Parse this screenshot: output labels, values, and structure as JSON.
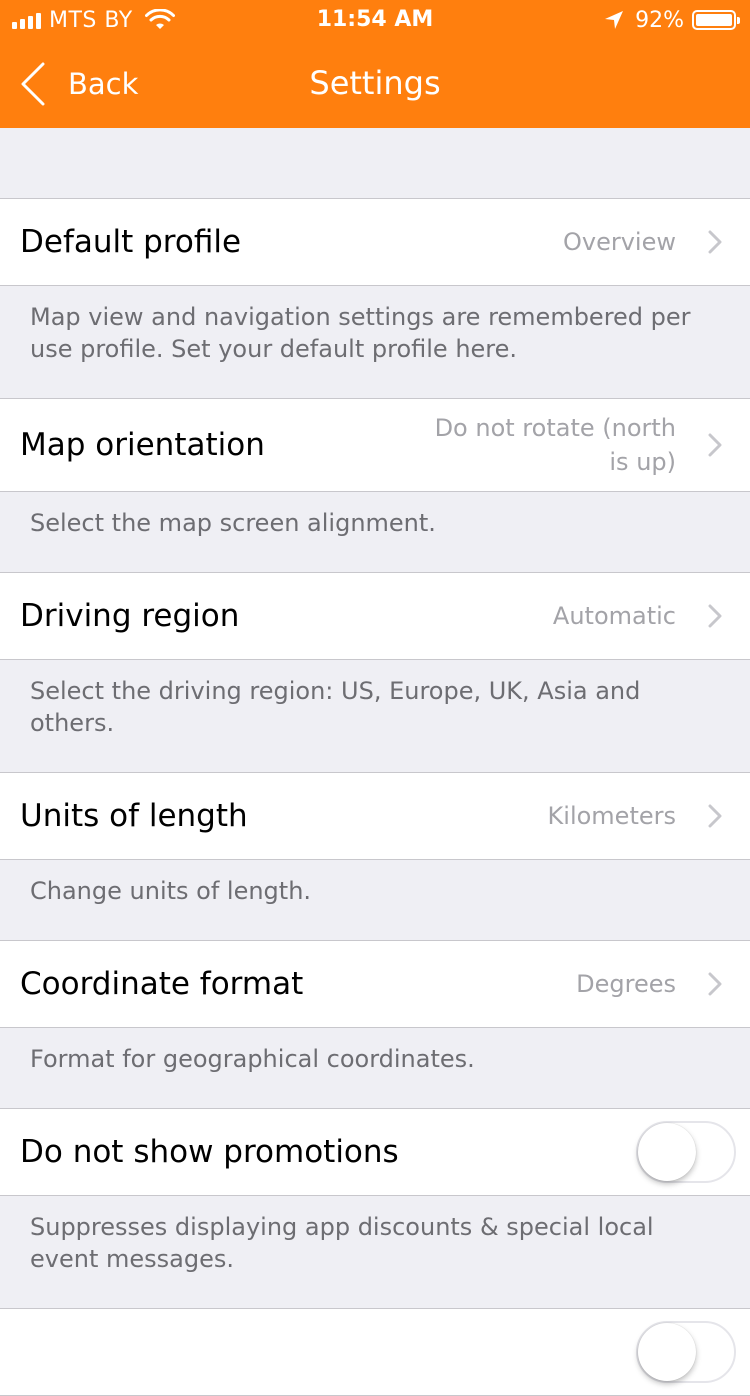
{
  "status_bar": {
    "carrier": "MTS BY",
    "time": "11:54 AM",
    "battery": "92%",
    "battery_level": 0.92,
    "icons": [
      "signal-icon",
      "wifi-icon",
      "location-arrow-icon",
      "battery-icon"
    ]
  },
  "nav": {
    "back_label": "Back",
    "title": "Settings",
    "bar_color": "#ff7f0e"
  },
  "settings": {
    "default_profile": {
      "label": "Default profile",
      "value": "Overview",
      "footer": "Map view and navigation settings are remembered per use profile. Set your default profile here."
    },
    "map_orientation": {
      "label": "Map orientation",
      "value_line1": "Do not rotate (north",
      "value_line2": "is up)",
      "footer": "Select the map screen alignment."
    },
    "driving_region": {
      "label": "Driving region",
      "value": "Automatic",
      "footer": "Select the driving region: US, Europe, UK, Asia and others."
    },
    "units_of_length": {
      "label": "Units of length",
      "value": "Kilometers",
      "footer": "Change units of length."
    },
    "coordinate_format": {
      "label": "Coordinate format",
      "value": "Degrees",
      "footer": "Format for geographical coordinates."
    },
    "do_not_show_promotions": {
      "label": "Do not show promotions",
      "toggle_on": false,
      "footer": "Suppresses displaying app discounts & special local event messages."
    },
    "next_toggle": {
      "toggle_on": false
    }
  }
}
